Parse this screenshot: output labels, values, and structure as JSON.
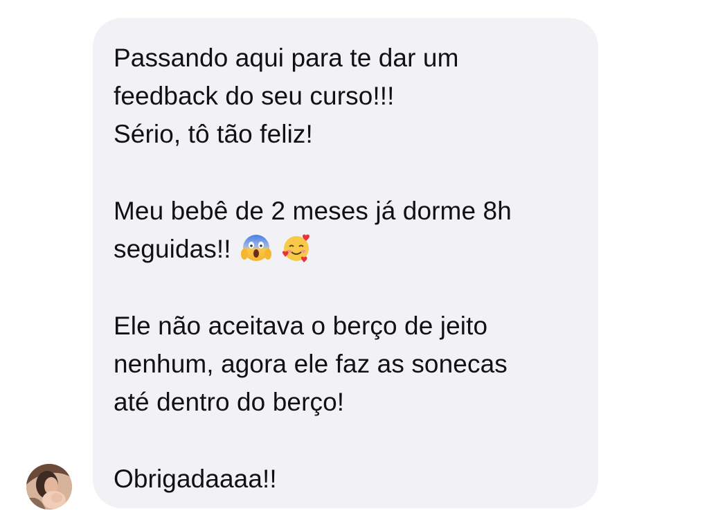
{
  "message": {
    "paragraphs": [
      {
        "lines": [
          "Passando aqui para te dar um",
          "feedback do seu curso!!!",
          "Sério, tô tão feliz!"
        ]
      },
      {
        "lines": [
          "Meu bebê de 2 meses já dorme 8h"
        ],
        "emoji_line": {
          "text": "seguidas!!",
          "emojis": [
            "face-screaming-in-fear-emoji",
            "smiling-face-with-hearts-emoji"
          ]
        }
      },
      {
        "lines": [
          "Ele não aceitava o berço de jeito",
          "nenhum, agora ele faz as sonecas",
          "até dentro do berço!"
        ]
      },
      {
        "lines": [
          "Obrigadaaaa!!"
        ]
      }
    ]
  },
  "sender": {
    "avatar_icon": "mother-with-baby-avatar"
  },
  "colors": {
    "bubble_background": "#f2f2f6",
    "text": "#111111",
    "page_background": "#ffffff"
  }
}
